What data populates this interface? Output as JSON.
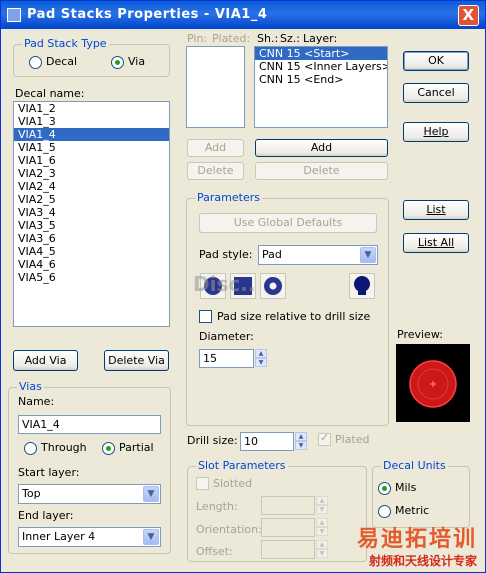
{
  "window": {
    "title": "Pad Stacks Properties - VIA1_4",
    "close_label": "X"
  },
  "pad_stack_type": {
    "title": "Pad Stack Type",
    "options": [
      {
        "label": "Decal",
        "selected": false
      },
      {
        "label": "Via",
        "selected": true
      }
    ]
  },
  "decal": {
    "label": "Decal name:",
    "items": [
      "VIA1_2",
      "VIA1_3",
      "VIA1_4",
      "VIA1_5",
      "VIA1_6",
      "VIA2_3",
      "VIA2_4",
      "VIA2_5",
      "VIA3_4",
      "VIA3_5",
      "VIA3_6",
      "VIA4_5",
      "VIA4_6",
      "VIA5_6"
    ],
    "selected": "VIA1_4"
  },
  "buttons": {
    "add_via": "Add Via",
    "delete_via": "Delete Via",
    "ok": "OK",
    "cancel": "Cancel",
    "help": "Help",
    "list": "List",
    "list_all": "List All",
    "add_pin": "Add",
    "delete_pin": "Delete",
    "add_layer": "Add",
    "delete_layer": "Delete",
    "use_global_defaults": "Use Global Defaults"
  },
  "pins": {
    "header_pin": "Pin:",
    "header_plated": "Plated:"
  },
  "layers": {
    "header_shape": "Sh.:",
    "header_size": "Sz.:",
    "header_layer": "Layer:",
    "items": [
      "CNN 15 <Start>",
      "CNN 15 <Inner Layers>",
      "CNN 15 <End>"
    ],
    "selected_index": 0
  },
  "parameters": {
    "title": "Parameters",
    "pad_style_label": "Pad style:",
    "pad_style_value": "Pad",
    "relative_label": "Pad size relative to drill size",
    "relative_checked": false,
    "diameter_label": "Diameter:",
    "diameter_value": "15",
    "shape_overlay_text": "Disc.."
  },
  "drill": {
    "label": "Drill size:",
    "value": "10",
    "plated_label": "Plated",
    "plated_checked": true
  },
  "preview": {
    "label": "Preview:",
    "pad_color": "#e02020"
  },
  "vias": {
    "title": "Vias",
    "name_label": "Name:",
    "name_value": "VIA1_4",
    "through_label": "Through",
    "partial_label": "Partial",
    "partial_selected": true,
    "start_layer_label": "Start layer:",
    "start_layer_value": "Top",
    "end_layer_label": "End layer:",
    "end_layer_value": "Inner Layer 4"
  },
  "slot": {
    "title": "Slot Parameters",
    "slotted_label": "Slotted",
    "length_label": "Length:",
    "orientation_label": "Orientation:",
    "offset_label": "Offset:"
  },
  "decal_units": {
    "title": "Decal Units",
    "mils_label": "Mils",
    "metric_label": "Metric",
    "mils_selected": true
  },
  "watermark": {
    "big": "易迪拓培训",
    "small": "射频和天线设计专家"
  }
}
